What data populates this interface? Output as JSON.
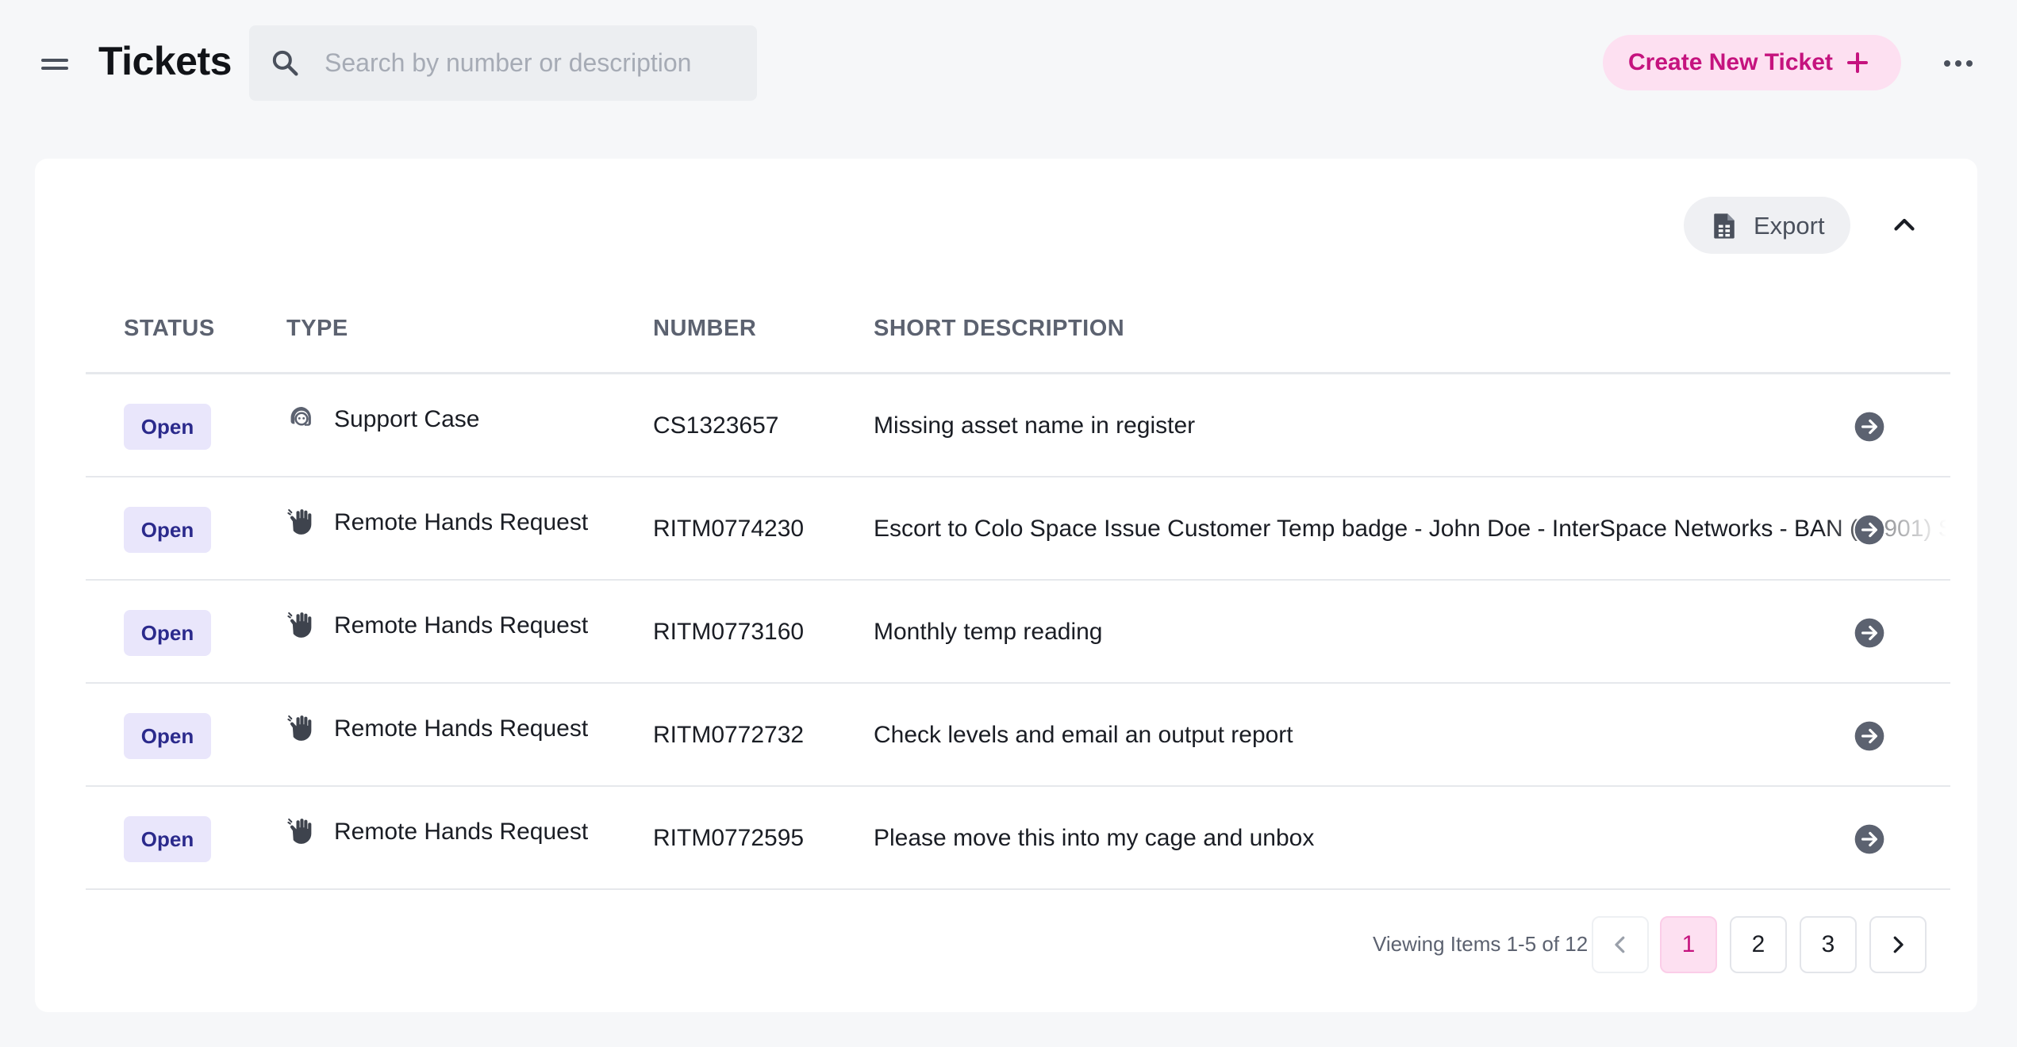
{
  "header": {
    "title": "Tickets",
    "search_placeholder": "Search by number or description",
    "search_value": "",
    "create_label": "Create New Ticket",
    "icons": [
      "menu-icon",
      "search-icon",
      "plus-icon",
      "more-icon"
    ]
  },
  "toolbar": {
    "export_label": "Export",
    "icons": [
      "export-icon",
      "chevron-up-icon"
    ]
  },
  "table": {
    "columns": [
      "STATUS",
      "TYPE",
      "NUMBER",
      "SHORT DESCRIPTION"
    ],
    "rows": [
      {
        "status": "Open",
        "type": "Support Case",
        "type_icon": "support-agent-icon",
        "number": "CS1323657",
        "description": "Missing asset name in register"
      },
      {
        "status": "Open",
        "type": "Remote Hands Request",
        "type_icon": "hand-icon",
        "number": "RITM0774230",
        "description": "Escort to Colo Space Issue Customer Temp badge - John Doe - InterSpace Networks - BAN (72901) S"
      },
      {
        "status": "Open",
        "type": "Remote Hands Request",
        "type_icon": "hand-icon",
        "number": "RITM0773160",
        "description": "Monthly temp reading"
      },
      {
        "status": "Open",
        "type": "Remote Hands Request",
        "type_icon": "hand-icon",
        "number": "RITM0772732",
        "description": "Check levels and email an output report"
      },
      {
        "status": "Open",
        "type": "Remote Hands Request",
        "type_icon": "hand-icon",
        "number": "RITM0772595",
        "description": "Please move this into my cage and unbox"
      }
    ]
  },
  "pagination": {
    "info": "Viewing Items 1-5 of 12",
    "pages": [
      "1",
      "2",
      "3"
    ],
    "current": "1"
  },
  "colors": {
    "accent": "#c5137e",
    "accent_bg": "#fde0f1",
    "badge_bg": "#e9e6fb",
    "badge_text": "#2b2a8c",
    "page_bg": "#f6f7f9"
  }
}
